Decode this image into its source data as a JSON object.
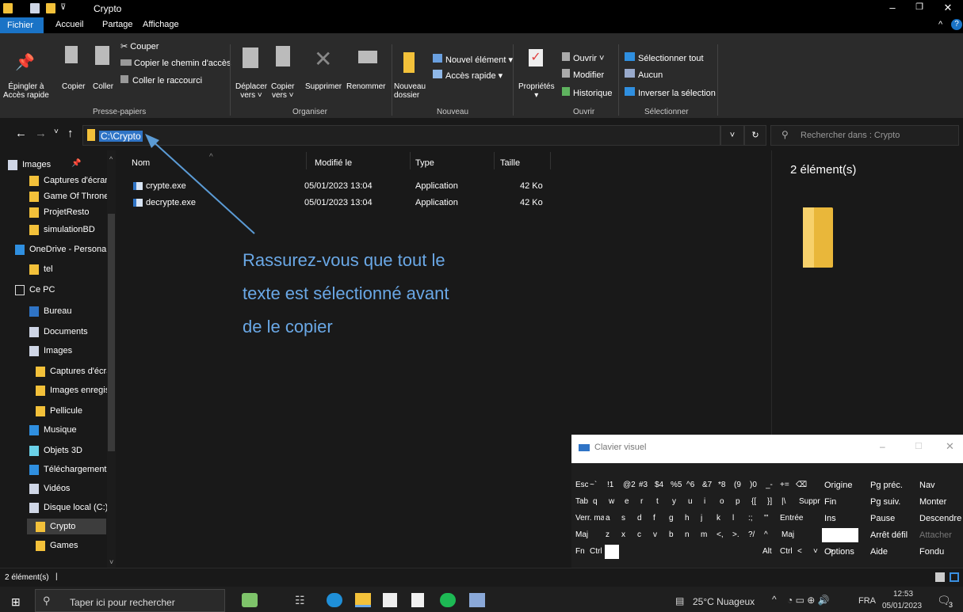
{
  "window": {
    "title": "Crypto",
    "minimize": "–",
    "maximize": "❐",
    "close": "✕"
  },
  "ribbon_tabs": [
    "Fichier",
    "Accueil",
    "Partage",
    "Affichage"
  ],
  "ribbon": {
    "pin_label1": "Épingler à",
    "pin_label2": "Accès rapide",
    "copy_label": "Copier",
    "paste_label": "Coller",
    "cut": "Couper",
    "copy_path": "Copier le chemin d'accès",
    "paste_shortcut": "Coller le raccourci",
    "group_clipboard": "Presse-papiers",
    "move_to1": "Déplacer",
    "move_to2": "vers ˅",
    "copy_to1": "Copier",
    "copy_to2": "vers ˅",
    "delete": "Supprimer",
    "rename": "Renommer",
    "group_organize": "Organiser",
    "new_folder1": "Nouveau",
    "new_folder2": "dossier",
    "new_item": "Nouvel élément ▾",
    "quick_access": "Accès rapide ▾",
    "group_new": "Nouveau",
    "properties": "Propriétés",
    "open": "Ouvrir ˅",
    "edit": "Modifier",
    "history": "Historique",
    "group_open": "Ouvrir",
    "select_all": "Sélectionner tout",
    "select_none": "Aucun",
    "invert": "Inverser la sélection",
    "group_select": "Sélectionner"
  },
  "address": {
    "path": "C:\\Crypto",
    "search_placeholder": "Rechercher dans : Crypto"
  },
  "nav_items": [
    {
      "label": "Images",
      "kind": "image"
    },
    {
      "label": "Captures d'écran",
      "kind": "folder"
    },
    {
      "label": "Game Of Thrones",
      "kind": "folder"
    },
    {
      "label": "ProjetResto",
      "kind": "folder"
    },
    {
      "label": "simulationBD",
      "kind": "folder"
    },
    {
      "label": "OneDrive - Personal",
      "kind": "cloud"
    },
    {
      "label": "tel",
      "kind": "folder"
    },
    {
      "label": "Ce PC",
      "kind": "pc"
    },
    {
      "label": "Bureau",
      "kind": "desk"
    },
    {
      "label": "Documents",
      "kind": "doc"
    },
    {
      "label": "Images",
      "kind": "image"
    },
    {
      "label": "Captures d'écran",
      "kind": "folder"
    },
    {
      "label": "Images enregistrées",
      "kind": "folder"
    },
    {
      "label": "Pellicule",
      "kind": "folder"
    },
    {
      "label": "Musique",
      "kind": "music"
    },
    {
      "label": "Objets 3D",
      "kind": "obj"
    },
    {
      "label": "Téléchargements",
      "kind": "dl"
    },
    {
      "label": "Vidéos",
      "kind": "video"
    },
    {
      "label": "Disque local (C:)",
      "kind": "disk"
    },
    {
      "label": "Crypto",
      "kind": "folder"
    },
    {
      "label": "Games",
      "kind": "folder"
    }
  ],
  "columns": {
    "name": "Nom",
    "modified": "Modifié le",
    "type": "Type",
    "size": "Taille"
  },
  "files": [
    {
      "name": "crypte.exe",
      "modified": "05/01/2023 13:04",
      "type": "Application",
      "size": "42 Ko"
    },
    {
      "name": "decrypte.exe",
      "modified": "05/01/2023 13:04",
      "type": "Application",
      "size": "42 Ko"
    }
  ],
  "preview": {
    "count": "2 élément(s)"
  },
  "annotation": {
    "line1": "Rassurez-vous que tout le",
    "line2": "texte est sélectionné avant",
    "line3": "de le copier"
  },
  "keyboard": {
    "title": "Clavier visuel",
    "row1": [
      "Esc",
      "~`",
      "!1",
      "@2",
      "#3",
      "$4",
      "%5",
      "^6",
      "&7",
      "*8",
      "(9",
      ")0",
      "_-",
      "+=",
      "⌫"
    ],
    "row2": [
      "Tab",
      "q",
      "w",
      "e",
      "r",
      "t",
      "y",
      "u",
      "i",
      "o",
      "p",
      "{[",
      "}]",
      "|\\",
      "Suppr"
    ],
    "row3": [
      "Verr. maj",
      "a",
      "s",
      "d",
      "f",
      "g",
      "h",
      "j",
      "k",
      "l",
      ":;",
      "\"'",
      "Entrée"
    ],
    "row4": [
      "Maj",
      "z",
      "x",
      "c",
      "v",
      "b",
      "n",
      "m",
      "<,",
      ">.",
      "?/",
      "^",
      "Maj"
    ],
    "row5": [
      "Fn",
      "Ctrl",
      "Alt",
      "Alt",
      "Ctrl",
      "<",
      "˅",
      ">"
    ],
    "side": [
      [
        "Origine",
        "Pg préc.",
        "Nav"
      ],
      [
        "Fin",
        "Pg suiv.",
        "Monter"
      ],
      [
        "Ins",
        "Pause",
        "Descendre"
      ],
      [
        "",
        "Arrêt défil",
        "Attacher"
      ],
      [
        "Options",
        "Aide",
        "Fondu"
      ]
    ]
  },
  "status": {
    "count": "2 élément(s)"
  },
  "taskbar": {
    "search_placeholder": "Taper ici pour rechercher",
    "weather": "25°C Nuageux",
    "lang": "FRA",
    "time": "12:53",
    "date": "05/01/2023",
    "notif": "3"
  }
}
